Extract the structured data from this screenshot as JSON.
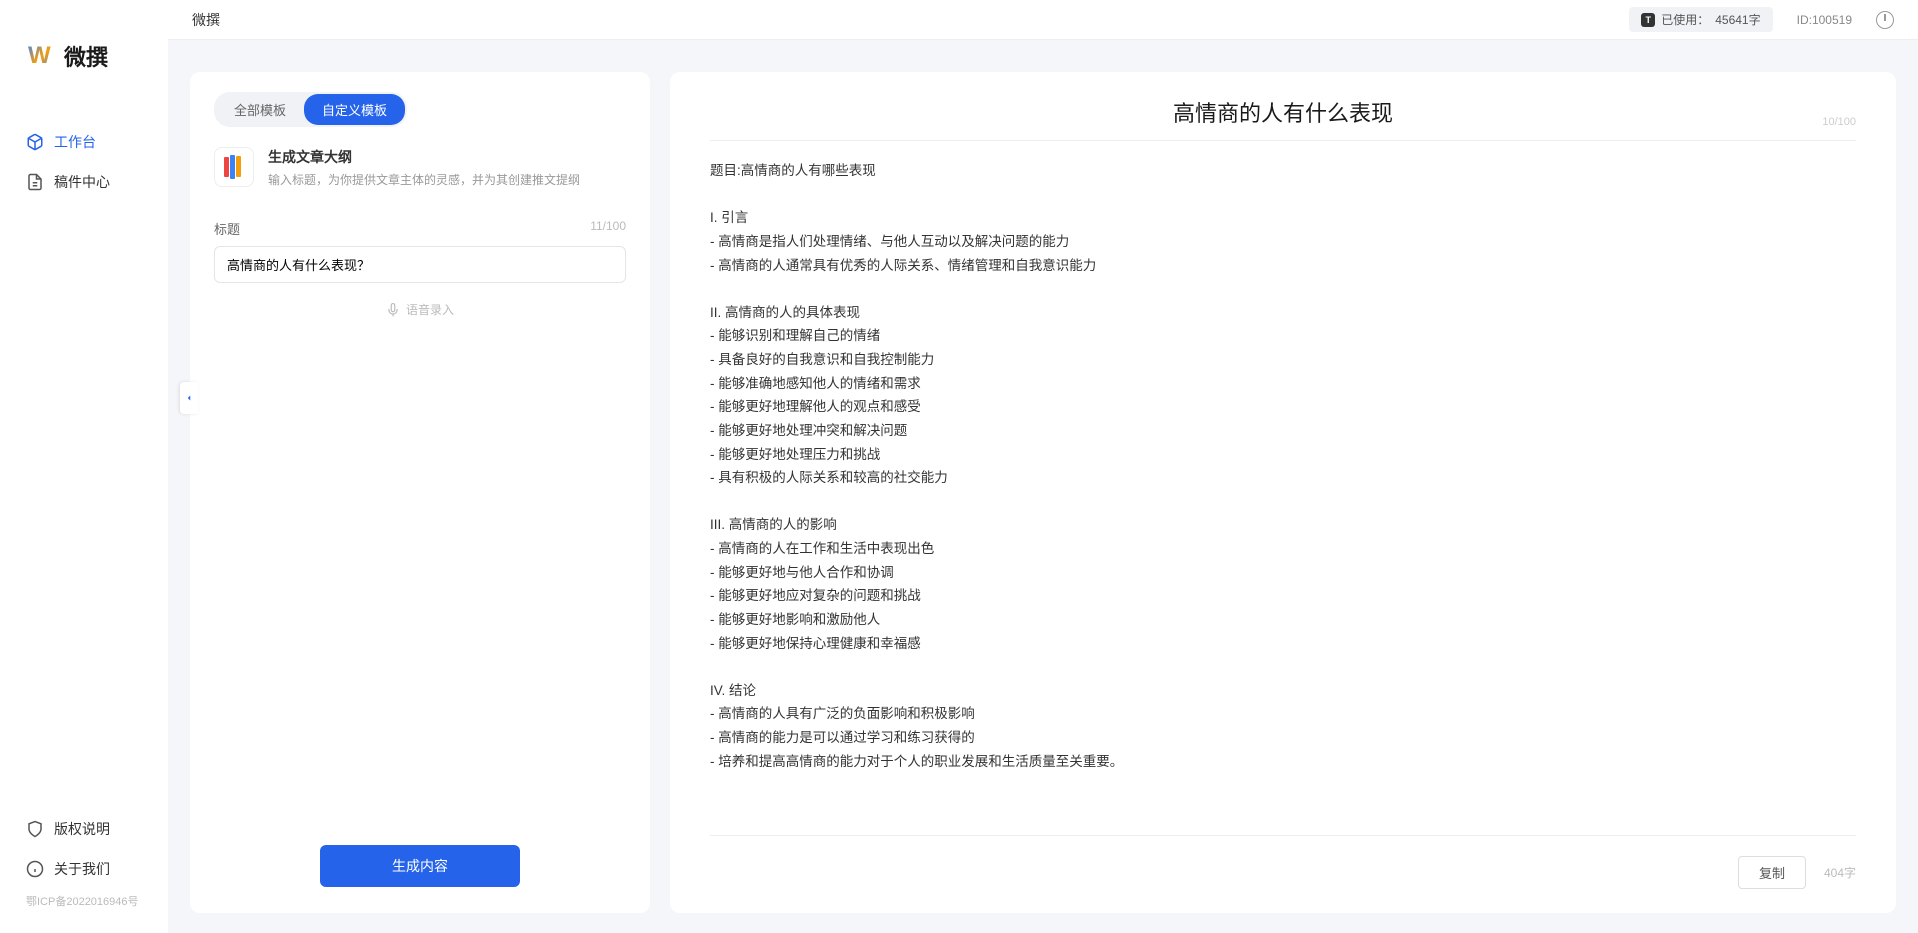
{
  "brand": {
    "text": "微撰"
  },
  "header": {
    "title": "微撰",
    "usage_label": "已使用：",
    "usage_value": "45641字",
    "user_id": "ID:100519"
  },
  "sidebar": {
    "nav": [
      {
        "label": "工作台"
      },
      {
        "label": "稿件中心"
      }
    ],
    "footer": [
      {
        "label": "版权说明"
      },
      {
        "label": "关于我们"
      }
    ],
    "icp": "鄂ICP备2022016946号"
  },
  "left": {
    "tabs": [
      {
        "label": "全部模板"
      },
      {
        "label": "自定义模板"
      }
    ],
    "template": {
      "name": "生成文章大纲",
      "desc": "输入标题，为你提供文章主体的灵感，并为其创建推文提纲"
    },
    "form": {
      "title_label": "标题",
      "title_count": "11/100",
      "title_value": "高情商的人有什么表现？",
      "voice_label": "语音录入"
    },
    "generate_btn": "生成内容"
  },
  "right": {
    "title": "高情商的人有什么表现",
    "title_count": "10/100",
    "body": "题目:高情商的人有哪些表现\n\nI. 引言\n- 高情商是指人们处理情绪、与他人互动以及解决问题的能力\n- 高情商的人通常具有优秀的人际关系、情绪管理和自我意识能力\n\nII. 高情商的人的具体表现\n- 能够识别和理解自己的情绪\n- 具备良好的自我意识和自我控制能力\n- 能够准确地感知他人的情绪和需求\n- 能够更好地理解他人的观点和感受\n- 能够更好地处理冲突和解决问题\n- 能够更好地处理压力和挑战\n- 具有积极的人际关系和较高的社交能力\n\nIII. 高情商的人的影响\n- 高情商的人在工作和生活中表现出色\n- 能够更好地与他人合作和协调\n- 能够更好地应对复杂的问题和挑战\n- 能够更好地影响和激励他人\n- 能够更好地保持心理健康和幸福感\n\nIV. 结论\n- 高情商的人具有广泛的负面影响和积极影响\n- 高情商的能力是可以通过学习和练习获得的\n- 培养和提高高情商的能力对于个人的职业发展和生活质量至关重要。",
    "copy_label": "复制",
    "word_count": "404字"
  }
}
